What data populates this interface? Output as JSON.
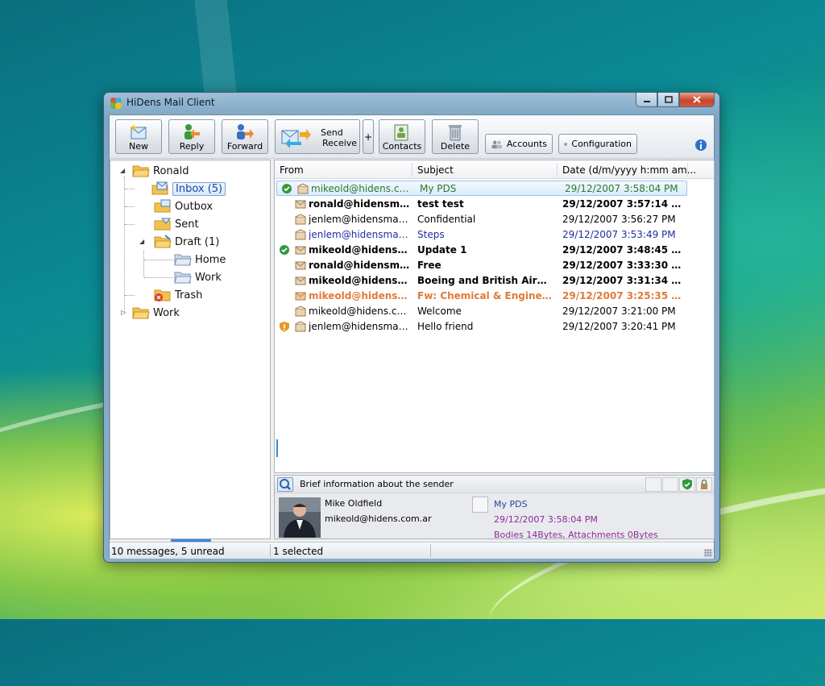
{
  "window": {
    "title": "HiDens Mail Client"
  },
  "toolbar": {
    "new_label": "New",
    "reply_label": "Reply",
    "forward_label": "Forward",
    "send_receive_label_1": "Send",
    "send_receive_label_2": "Receive",
    "plus_label": "+",
    "contacts_label": "Contacts",
    "delete_label": "Delete",
    "accounts_label": "Accounts",
    "configuration_label": "Configuration"
  },
  "folders": {
    "root": "Ronald",
    "inbox": "Inbox (5)",
    "outbox": "Outbox",
    "sent": "Sent",
    "draft": "Draft (1)",
    "draft_home": "Home",
    "draft_work": "Work",
    "trash": "Trash",
    "work": "Work"
  },
  "columns": {
    "from": "From",
    "subject": "Subject",
    "date": "Date (d/m/yyyy h:mm am..."
  },
  "messages": [
    {
      "from": "mikeold@hidens.com...",
      "subject": "My PDS",
      "date": "29/12/2007 3:58:04 PM",
      "status": "verified"
    },
    {
      "from": "ronald@hidensmail.c...",
      "subject": "test test",
      "date": "29/12/2007 3:57:14 PM",
      "status": ""
    },
    {
      "from": "jenlem@hidensmail.c...",
      "subject": "Confidential",
      "date": "29/12/2007 3:56:27 PM",
      "status": ""
    },
    {
      "from": "jenlem@hidensmail.c...",
      "subject": "Steps",
      "date": "29/12/2007 3:53:49 PM",
      "status": ""
    },
    {
      "from": "mikeold@hidens.co...",
      "subject": "Update 1",
      "date": "29/12/2007 3:48:45 PM",
      "status": "verified"
    },
    {
      "from": "ronald@hidensmail.c...",
      "subject": "Free",
      "date": "29/12/2007 3:33:30 PM",
      "status": ""
    },
    {
      "from": "mikeold@hidens.co...",
      "subject": "Boeing and British Airways F...",
      "date": "29/12/2007 3:31:34 PM",
      "status": ""
    },
    {
      "from": "mikeold@hidens.co...",
      "subject": "Fw: Chemical & Engineering ...",
      "date": "29/12/2007 3:25:35 PM",
      "status": ""
    },
    {
      "from": "mikeold@hidens.com...",
      "subject": "Welcome",
      "date": "29/12/2007 3:21:00 PM",
      "status": ""
    },
    {
      "from": "jenlem@hidensmail.c...",
      "subject": "Hello friend",
      "date": "29/12/2007 3:20:41 PM",
      "status": "warning"
    }
  ],
  "sender_info": {
    "title": "Brief information about the sender",
    "name": "Mike Oldfield",
    "email": "mikeold@hidens.com.ar",
    "subject": "My PDS",
    "date": "29/12/2007 3:58:04 PM",
    "sizes": "Bodies 14Bytes, Attachments 0Bytes"
  },
  "status_bar": {
    "count": "10 messages, 5 unread",
    "selected": "1 selected"
  },
  "colors": {
    "verified_green": "#2b7a2b",
    "unread_blue": "#1f2fa0",
    "highlight_orange": "#e07a35",
    "meta_purple": "#8e2a97"
  }
}
